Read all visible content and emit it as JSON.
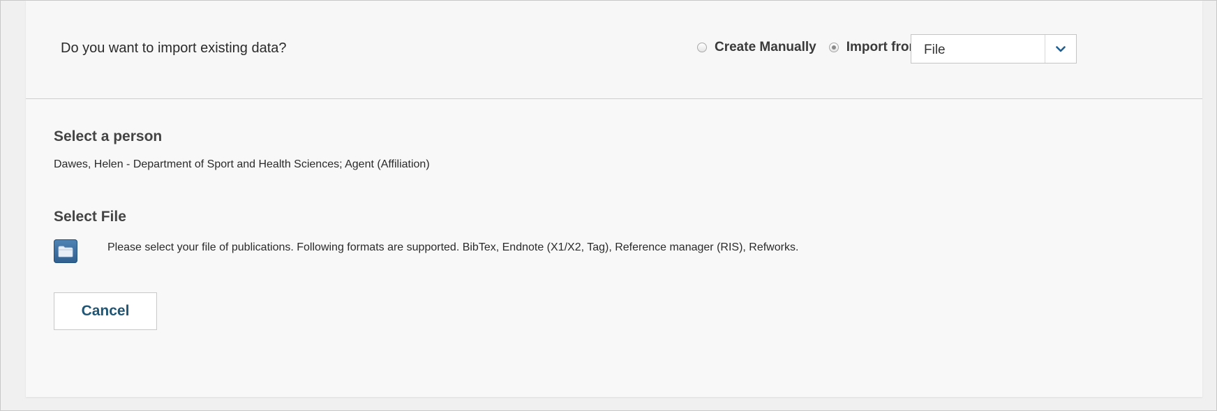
{
  "import": {
    "question": "Do you want to import existing data?",
    "options": [
      {
        "label": "Create Manually",
        "selected": false
      },
      {
        "label": "Import from",
        "selected": true
      }
    ],
    "source_select": {
      "value": "File",
      "icon": "chevron-down-icon"
    }
  },
  "person": {
    "heading": "Select a person",
    "value": "Dawes, Helen - Department of Sport and Health Sciences; Agent (Affiliation)"
  },
  "file": {
    "heading": "Select File",
    "icon": "folder-icon",
    "description": "Please select your file of publications. Following formats are supported. BibTex, Endnote (X1/X2, Tag), Reference manager (RIS), Refworks."
  },
  "actions": {
    "cancel_label": "Cancel"
  },
  "colors": {
    "accent": "#1f5575",
    "icon_blue": "#3a6f9f"
  }
}
